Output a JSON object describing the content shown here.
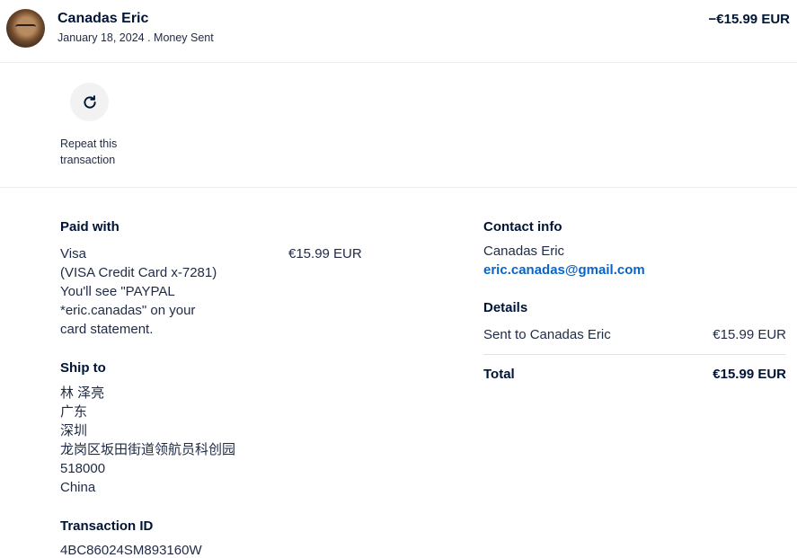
{
  "header": {
    "name": "Canadas Eric",
    "date": "January 18, 2024",
    "separator": " . ",
    "type": "Money Sent",
    "amount": "−€15.99 EUR"
  },
  "repeat": {
    "line1": "Repeat this",
    "line2": "transaction",
    "icon": "refresh-icon"
  },
  "paid_with": {
    "heading": "Paid with",
    "lines": [
      "Visa",
      "(VISA Credit Card x-7281)",
      "You'll see \"PAYPAL",
      "*eric.canadas\" on your",
      "card statement."
    ],
    "amount": "€15.99 EUR"
  },
  "ship_to": {
    "heading": "Ship to",
    "lines": [
      "林 泽亮",
      "广东",
      "深圳",
      "龙岗区坂田街道领航员科创园",
      "518000",
      "China"
    ]
  },
  "transaction": {
    "heading": "Transaction ID",
    "id": "4BC86024SM893160W"
  },
  "contact": {
    "heading": "Contact info",
    "name": "Canadas Eric",
    "email": "eric.canadas@gmail.com"
  },
  "details": {
    "heading": "Details",
    "sent_label": "Sent to Canadas Eric",
    "sent_amount": "€15.99 EUR",
    "total_label": "Total",
    "total_amount": "€15.99 EUR"
  },
  "colors": {
    "text_primary": "#001435",
    "link": "#0b64c5",
    "divider": "#ececec"
  }
}
